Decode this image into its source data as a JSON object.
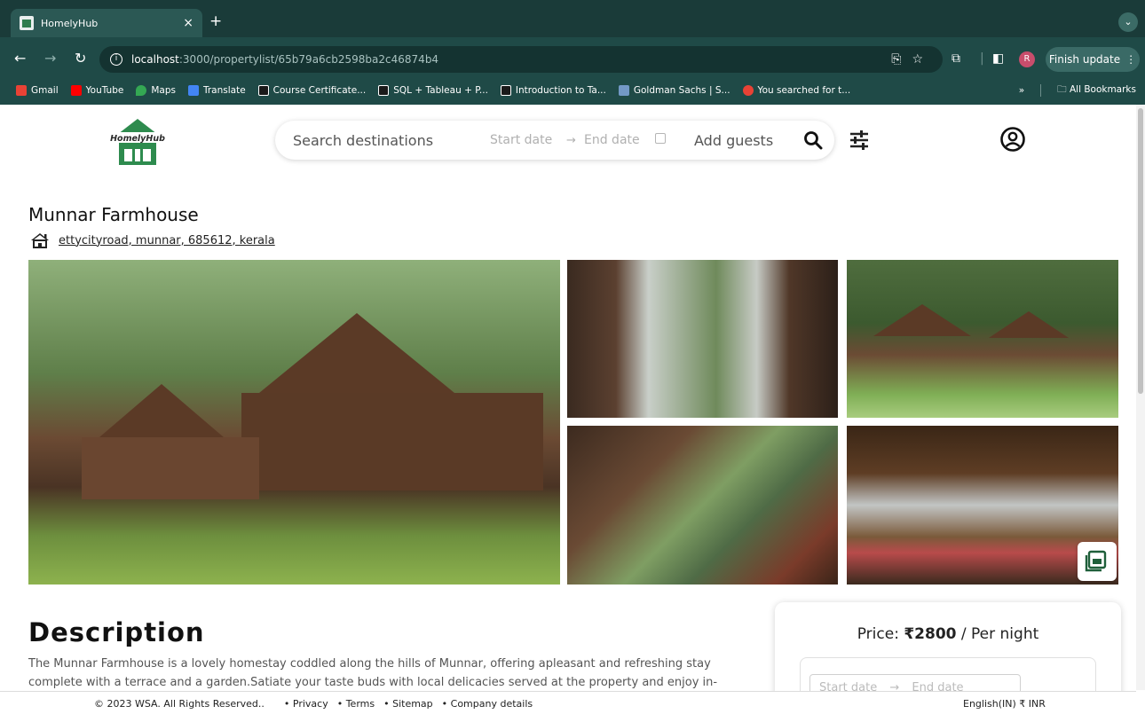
{
  "browser": {
    "tab_title": "HomelyHub",
    "tab_close": "×",
    "new_tab": "+",
    "url_host": "localhost",
    "url_path": ":3000/propertylist/65b79a6cb2598ba2c46874b4",
    "profile_initial": "R",
    "finish_update": "Finish update",
    "bookmarks": [
      {
        "label": "Gmail",
        "color": "#e94235"
      },
      {
        "label": "YouTube",
        "color": "#ff0000"
      },
      {
        "label": "Maps",
        "color": "#34a853"
      },
      {
        "label": "Translate",
        "color": "#4285f4"
      },
      {
        "label": "Course Certificate...",
        "color": "#1a1a1a"
      },
      {
        "label": "SQL + Tableau + P...",
        "color": "#1a1a1a"
      },
      {
        "label": "Introduction to Ta...",
        "color": "#1a1a1a"
      },
      {
        "label": "Goldman Sachs | S...",
        "color": "#7399c6"
      },
      {
        "label": "You searched for t...",
        "color": "#e94235"
      }
    ],
    "more_bookmarks": "»",
    "all_bookmarks": "All Bookmarks"
  },
  "header": {
    "logo_text": "HomelyHub",
    "search_placeholder": "Search destinations",
    "start_date": "Start date",
    "date_arrow": "→",
    "end_date": "End date",
    "add_guests": "Add guests"
  },
  "property": {
    "title": "Munnar Farmhouse",
    "address": "ettycityroad, munnar, 685612, kerala"
  },
  "description": {
    "heading": "Description",
    "text": "The Munnar Farmhouse is a lovely homestay coddled along the hills of Munnar, offering apleasant and refreshing stay complete with a terrace and a garden.Satiate your taste buds with local delicacies served at the property and enjoy in-"
  },
  "price_card": {
    "prefix": "Price: ",
    "amount": "₹2800",
    "suffix": " / Per night",
    "start_date": "Start date",
    "end_date": "End date"
  },
  "footer": {
    "copyright": "© 2023 WSA. All Rights Reserved..",
    "links": [
      "• Privacy",
      "• Terms",
      "• Sitemap",
      "• Company details"
    ],
    "locale": "English(IN) ₹ INR"
  },
  "colors": {
    "chrome": "#1f4a47",
    "logo_green": "#2e8b4e"
  }
}
